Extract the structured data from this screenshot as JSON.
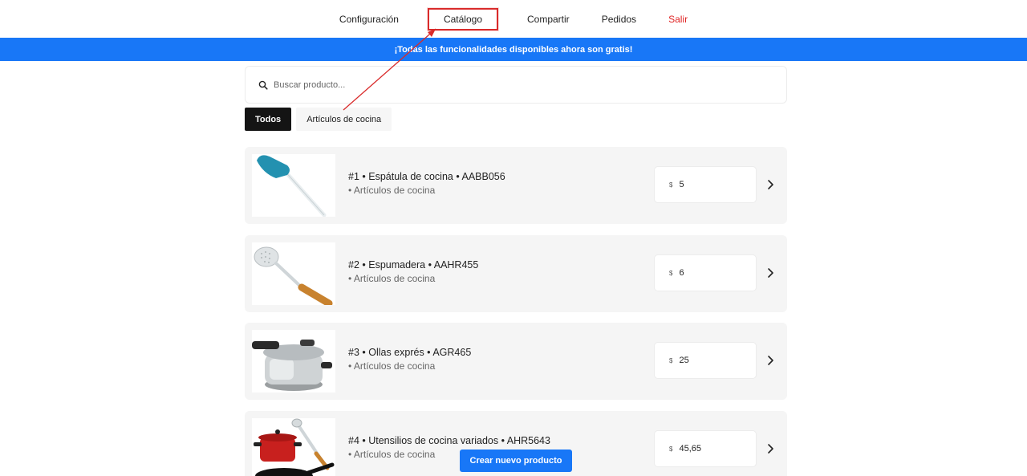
{
  "nav": {
    "config": "Configuración",
    "catalog": "Catálogo",
    "share": "Compartir",
    "orders": "Pedidos",
    "exit": "Salir"
  },
  "banner": "¡Todas las funcionalidades disponibles ahora son gratis!",
  "search": {
    "placeholder": "Buscar producto..."
  },
  "filters": [
    "Todos",
    "Artículos de cocina"
  ],
  "products": [
    {
      "title": "#1 • Espátula de cocina • AABB056",
      "category": "• Artículos de cocina",
      "currency": "$",
      "price": "5",
      "icon": "spatula-image"
    },
    {
      "title": "#2 • Espumadera • AAHR455",
      "category": "• Artículos de cocina",
      "currency": "$",
      "price": "6",
      "icon": "skimmer-image"
    },
    {
      "title": "#3 • Ollas exprés • AGR465",
      "category": "• Artículos de cocina",
      "currency": "$",
      "price": "25",
      "icon": "pressure-cooker-image"
    },
    {
      "title": "#4 • Utensilios de cocina variados • AHR5643",
      "category": "• Artículos de cocina",
      "currency": "$",
      "price": "45,65",
      "icon": "cookware-set-image"
    }
  ],
  "create_button": "Crear nuevo producto",
  "colors": {
    "accent": "#1877f7",
    "exit": "#e02424",
    "annotation": "#d92b2b"
  }
}
